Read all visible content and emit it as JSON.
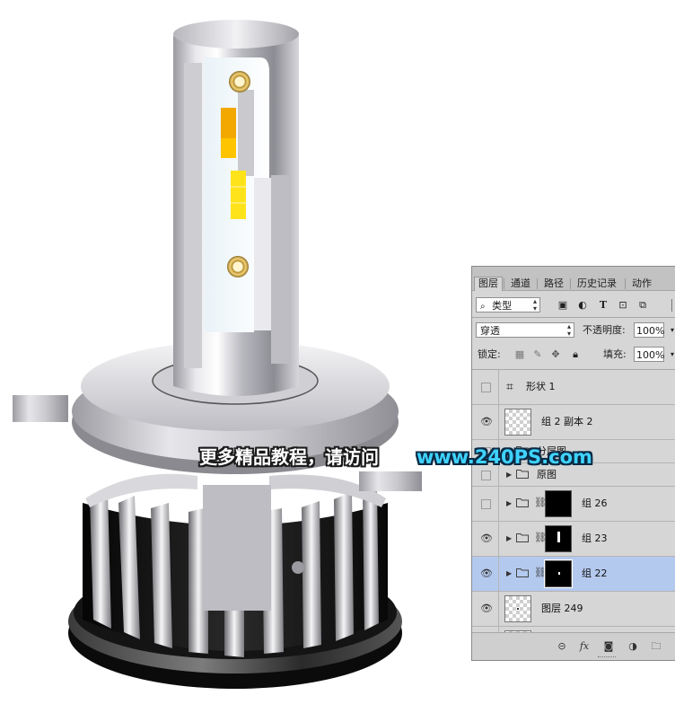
{
  "panel": {
    "tabs": [
      "图层",
      "通道",
      "路径",
      "历史记录",
      "动作"
    ],
    "filter_label": "类型",
    "blend_mode": "穿透",
    "opacity_label": "不透明度:",
    "opacity_value": "100%",
    "lock_label": "锁定:",
    "fill_label": "填充:",
    "fill_value": "100%",
    "layers": [
      {
        "name": "形状 1",
        "visible": false,
        "kind": "shape"
      },
      {
        "name": "组 2 副本 2",
        "visible": true,
        "kind": "pixel"
      },
      {
        "name": "分层图",
        "visible": false,
        "kind": "group"
      },
      {
        "name": "原图",
        "visible": false,
        "kind": "group"
      },
      {
        "name": "组 26",
        "visible": false,
        "kind": "group-mask"
      },
      {
        "name": "组 23",
        "visible": true,
        "kind": "group-mask"
      },
      {
        "name": "组 22",
        "visible": true,
        "kind": "group-mask",
        "selected": true
      },
      {
        "name": "图层 249",
        "visible": true,
        "kind": "pixel"
      }
    ],
    "icons": {
      "eye": "eye-icon",
      "folder": "folder-icon",
      "link": "link-icon"
    }
  },
  "watermark": {
    "cn": "更多精品教程，请访问",
    "url": "www.240PS.com"
  },
  "colors": {
    "accent_url": "#3fd3ff",
    "selected_row": "#b4c9ee",
    "led_yellow": "#ffd400"
  }
}
